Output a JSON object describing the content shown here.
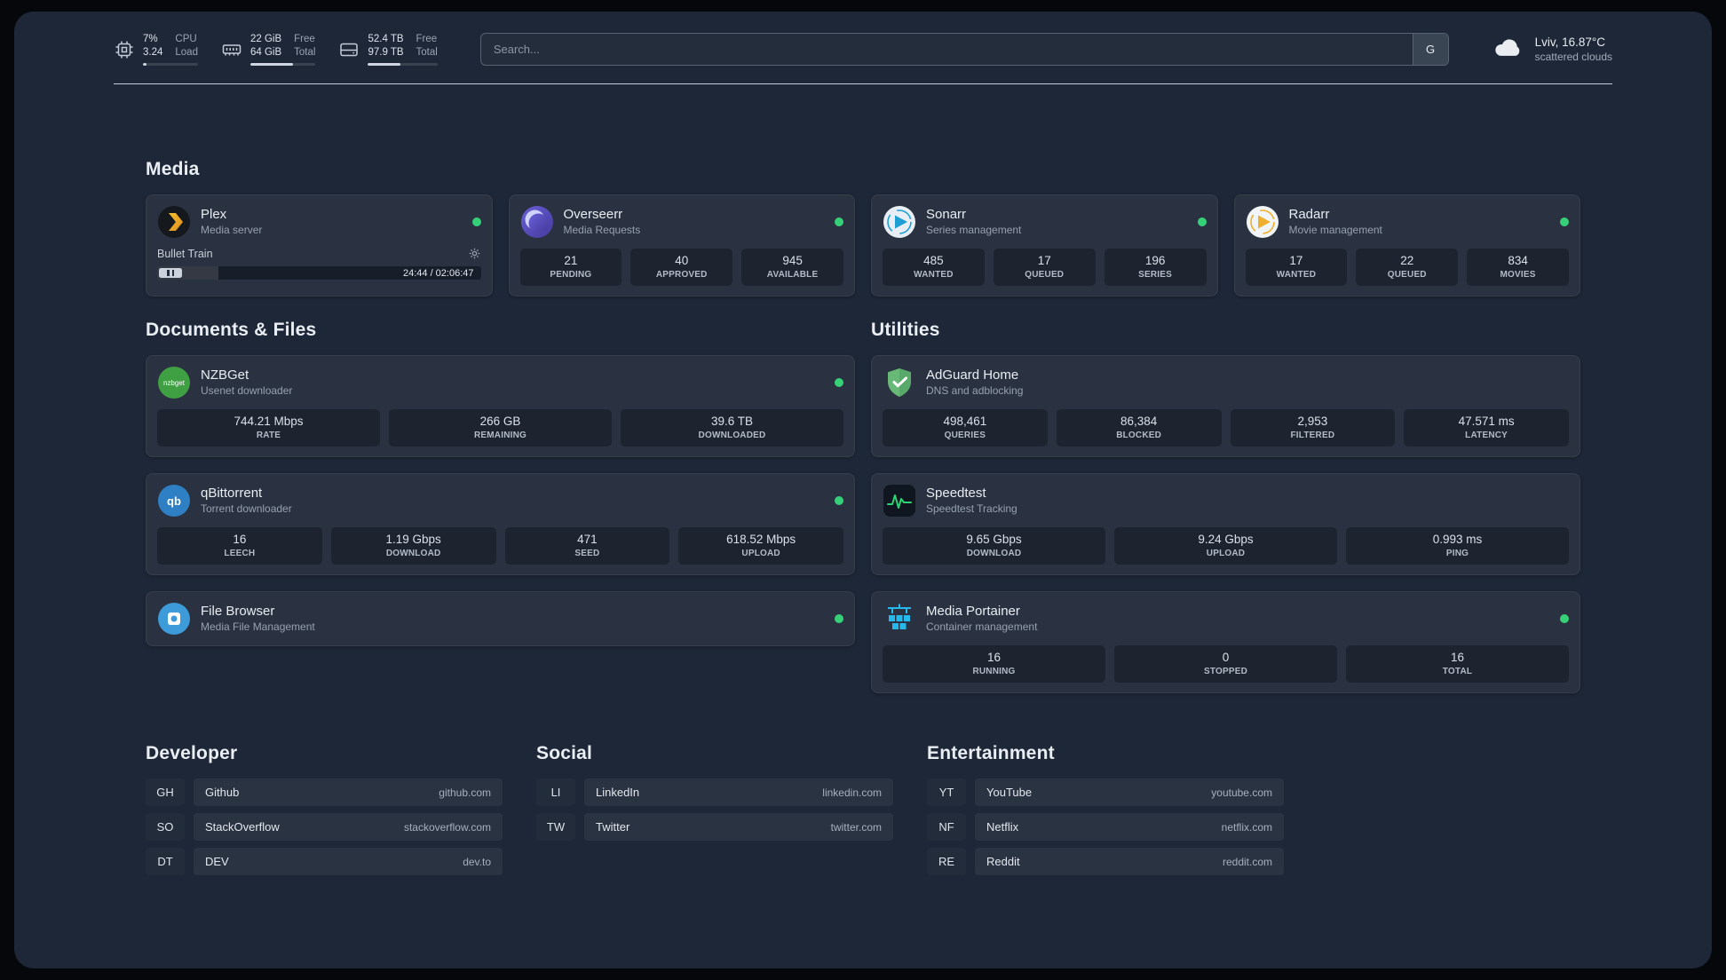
{
  "topbar": {
    "resources": [
      {
        "top_value": "7%",
        "bottom_value": "3.24",
        "top_label": "CPU",
        "bottom_label": "Load",
        "progress": 7
      },
      {
        "top_value": "22 GiB",
        "bottom_value": "64 GiB",
        "top_label": "Free",
        "bottom_label": "Total",
        "progress": 66
      },
      {
        "top_value": "52.4 TB",
        "bottom_value": "97.9 TB",
        "top_label": "Free",
        "bottom_label": "Total",
        "progress": 46
      }
    ],
    "search": {
      "placeholder": "Search...",
      "button_label": "G"
    },
    "weather": {
      "location": "Lviv, 16.87°C",
      "condition": "scattered clouds"
    }
  },
  "sections": {
    "media": "Media",
    "documents": "Documents & Files",
    "utilities": "Utilities"
  },
  "services": {
    "plex": {
      "name": "Plex",
      "desc": "Media server",
      "track": "Bullet Train",
      "time": "24:44 / 02:06:47",
      "progress": 19
    },
    "overseerr": {
      "name": "Overseerr",
      "desc": "Media Requests",
      "stats": [
        {
          "value": "21",
          "label": "PENDING"
        },
        {
          "value": "40",
          "label": "APPROVED"
        },
        {
          "value": "945",
          "label": "AVAILABLE"
        }
      ]
    },
    "sonarr": {
      "name": "Sonarr",
      "desc": "Series management",
      "stats": [
        {
          "value": "485",
          "label": "WANTED"
        },
        {
          "value": "17",
          "label": "QUEUED"
        },
        {
          "value": "196",
          "label": "SERIES"
        }
      ]
    },
    "radarr": {
      "name": "Radarr",
      "desc": "Movie management",
      "stats": [
        {
          "value": "17",
          "label": "WANTED"
        },
        {
          "value": "22",
          "label": "QUEUED"
        },
        {
          "value": "834",
          "label": "MOVIES"
        }
      ]
    },
    "nzbget": {
      "name": "NZBGet",
      "desc": "Usenet downloader",
      "stats": [
        {
          "value": "744.21 Mbps",
          "label": "RATE"
        },
        {
          "value": "266 GB",
          "label": "REMAINING"
        },
        {
          "value": "39.6 TB",
          "label": "DOWNLOADED"
        }
      ]
    },
    "qbittorrent": {
      "name": "qBittorrent",
      "desc": "Torrent downloader",
      "stats": [
        {
          "value": "16",
          "label": "LEECH"
        },
        {
          "value": "1.19 Gbps",
          "label": "DOWNLOAD"
        },
        {
          "value": "471",
          "label": "SEED"
        },
        {
          "value": "618.52 Mbps",
          "label": "UPLOAD"
        }
      ]
    },
    "filebrowser": {
      "name": "File Browser",
      "desc": "Media File Management"
    },
    "adguard": {
      "name": "AdGuard Home",
      "desc": "DNS and adblocking",
      "stats": [
        {
          "value": "498,461",
          "label": "QUERIES"
        },
        {
          "value": "86,384",
          "label": "BLOCKED"
        },
        {
          "value": "2,953",
          "label": "FILTERED"
        },
        {
          "value": "47.571 ms",
          "label": "LATENCY"
        }
      ]
    },
    "speedtest": {
      "name": "Speedtest",
      "desc": "Speedtest Tracking",
      "stats": [
        {
          "value": "9.65 Gbps",
          "label": "DOWNLOAD"
        },
        {
          "value": "9.24 Gbps",
          "label": "UPLOAD"
        },
        {
          "value": "0.993 ms",
          "label": "PING"
        }
      ]
    },
    "portainer": {
      "name": "Media Portainer",
      "desc": "Container management",
      "stats": [
        {
          "value": "16",
          "label": "RUNNING"
        },
        {
          "value": "0",
          "label": "STOPPED"
        },
        {
          "value": "16",
          "label": "TOTAL"
        }
      ]
    }
  },
  "icons": {
    "nzbget_text": "nzbget",
    "qbittorrent_text": "qb"
  },
  "bookmarks": [
    {
      "title": "Developer",
      "items": [
        {
          "abbr": "GH",
          "name": "Github",
          "url": "github.com"
        },
        {
          "abbr": "SO",
          "name": "StackOverflow",
          "url": "stackoverflow.com"
        },
        {
          "abbr": "DT",
          "name": "DEV",
          "url": "dev.to"
        }
      ]
    },
    {
      "title": "Social",
      "items": [
        {
          "abbr": "LI",
          "name": "LinkedIn",
          "url": "linkedin.com"
        },
        {
          "abbr": "TW",
          "name": "Twitter",
          "url": "twitter.com"
        }
      ]
    },
    {
      "title": "Entertainment",
      "items": [
        {
          "abbr": "YT",
          "name": "YouTube",
          "url": "youtube.com"
        },
        {
          "abbr": "NF",
          "name": "Netflix",
          "url": "netflix.com"
        },
        {
          "abbr": "RE",
          "name": "Reddit",
          "url": "reddit.com"
        }
      ]
    }
  ],
  "colors": {
    "status_online": "#35d077",
    "background": "#1d2737",
    "card": "#2a3241"
  }
}
